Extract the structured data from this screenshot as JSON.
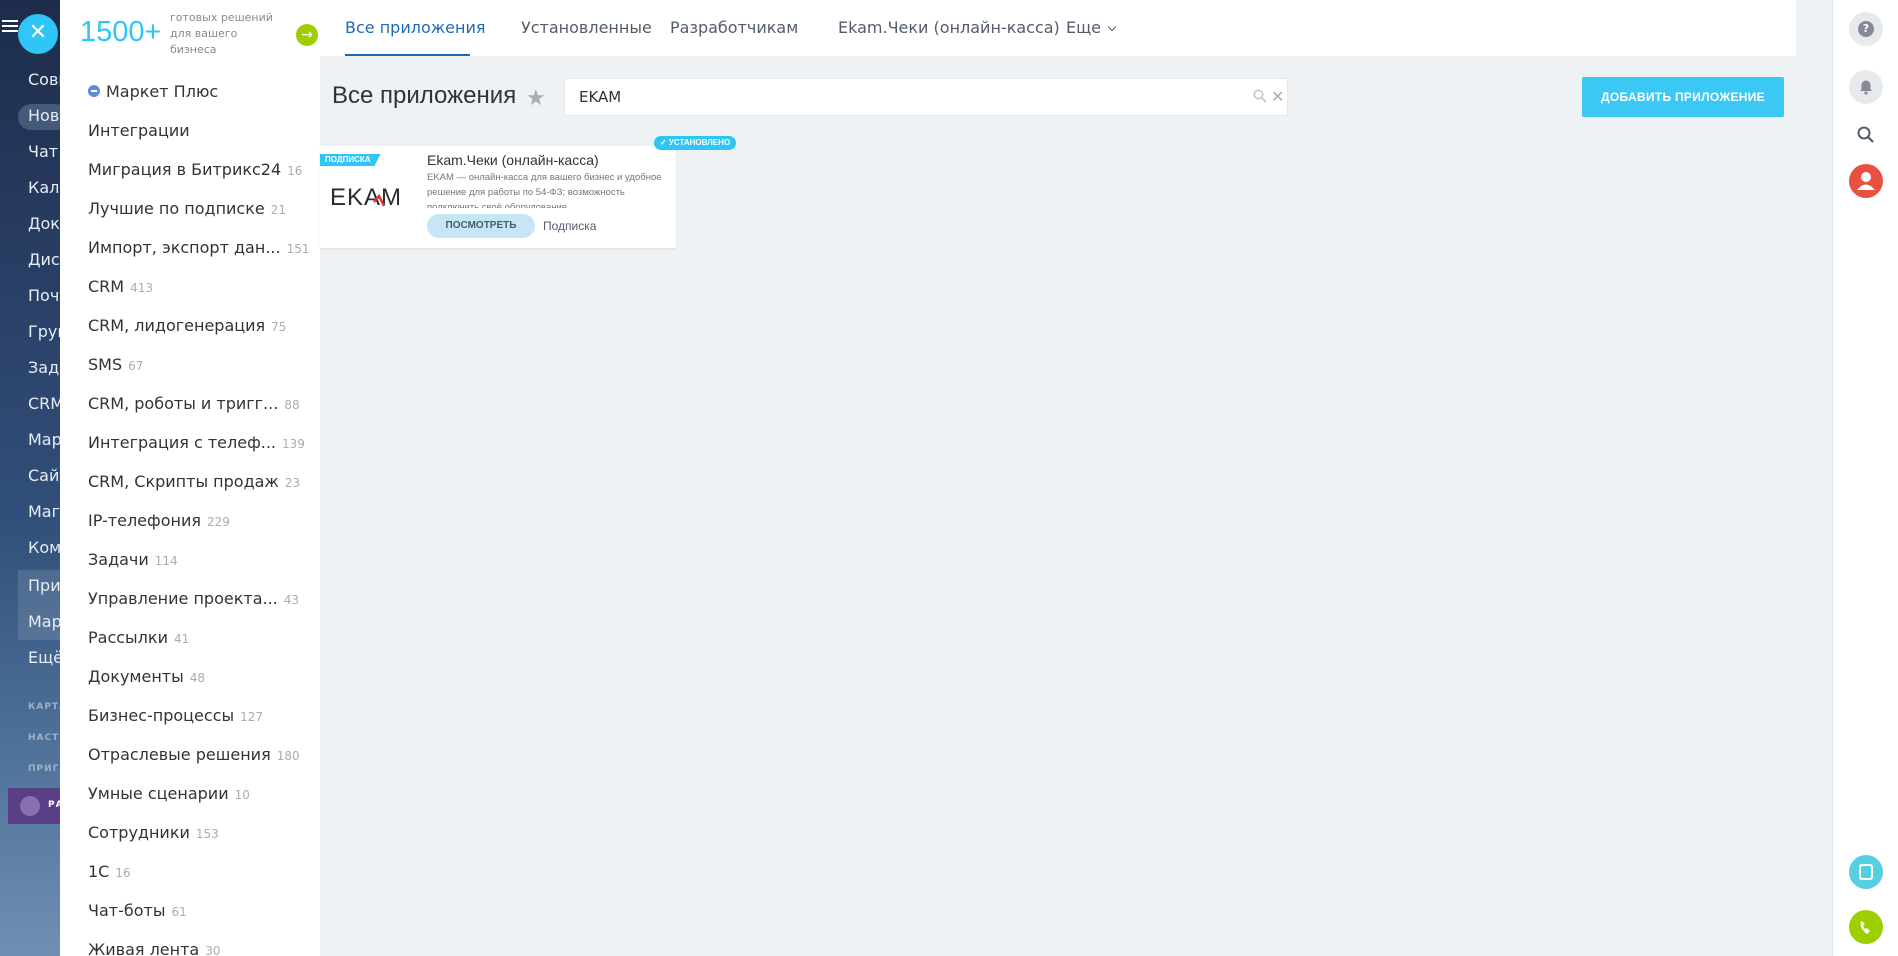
{
  "background": {
    "menu_items": [
      "Совм",
      "Ново",
      "Чат",
      "Кале",
      "Доку",
      "Диск",
      "Почт",
      "Груп",
      "Зада",
      "CRM",
      "Мар",
      "Сайт",
      "Мага",
      "Ком",
      "При",
      "Мар",
      "Ещё"
    ],
    "small_labels": [
      "КАРТА",
      "НАСТ",
      "ПРИГЛ"
    ],
    "crown_label": "РА"
  },
  "promo": {
    "number": "1500+",
    "text": "готовых решений для вашего бизнеса"
  },
  "sidebar": {
    "items": [
      {
        "label": "Маркет Плюс",
        "count": ""
      },
      {
        "label": "Интеграции",
        "count": ""
      },
      {
        "label": "Миграция в Битрикс24",
        "count": "16"
      },
      {
        "label": "Лучшие по подписке",
        "count": "21"
      },
      {
        "label": "Импорт, экспорт дан...",
        "count": "151"
      },
      {
        "label": "CRM",
        "count": "413"
      },
      {
        "label": "CRM, лидогенерация",
        "count": "75"
      },
      {
        "label": "SMS",
        "count": "67"
      },
      {
        "label": "CRM, роботы и тригг...",
        "count": "88"
      },
      {
        "label": "Интеграция с телеф...",
        "count": "139"
      },
      {
        "label": "CRM, Скрипты продаж",
        "count": "23"
      },
      {
        "label": "IP-телефония",
        "count": "229"
      },
      {
        "label": "Задачи",
        "count": "114"
      },
      {
        "label": "Управление проекта...",
        "count": "43"
      },
      {
        "label": "Рассылки",
        "count": "41"
      },
      {
        "label": "Документы",
        "count": "48"
      },
      {
        "label": "Бизнес-процессы",
        "count": "127"
      },
      {
        "label": "Отраслевые решения",
        "count": "180"
      },
      {
        "label": "Умные сценарии",
        "count": "10"
      },
      {
        "label": "Сотрудники",
        "count": "153"
      },
      {
        "label": "1С",
        "count": "16"
      },
      {
        "label": "Чат-боты",
        "count": "61"
      },
      {
        "label": "Живая лента",
        "count": "30"
      }
    ]
  },
  "tabs": [
    {
      "label": "Все приложения"
    },
    {
      "label": "Установленные"
    },
    {
      "label": "Разработчикам"
    },
    {
      "label": "Ekam.Чеки (онлайн-касса)"
    },
    {
      "label": "Еще"
    }
  ],
  "main": {
    "title": "Все приложения",
    "search_value": "EKAM",
    "add_button": "ДОБАВИТЬ ПРИЛОЖЕНИЕ"
  },
  "card": {
    "ribbon": "ПОДПИСКА",
    "badge": "✓ УСТАНОВЛЕНО",
    "logo_text": "EKAM",
    "title": "Ekam.Чеки (онлайн-касса)",
    "description": "EKAM — онлайн-касса для вашего бизнес и удобное решение для работы по 54-ФЗ; возможность подключить своё оборудование",
    "view_button": "ПОСМОТРЕТЬ",
    "type_label": "Подписка"
  },
  "colors": {
    "accent": "#2fc6f6",
    "active_tab": "#1f6ab5",
    "green": "#9dcf00",
    "avatar": "#e85040"
  },
  "icons": {
    "close": "close-icon",
    "search": "search-icon",
    "star": "star-icon",
    "help": "help-icon",
    "bell": "bell-icon",
    "avatar": "user-avatar-icon"
  }
}
